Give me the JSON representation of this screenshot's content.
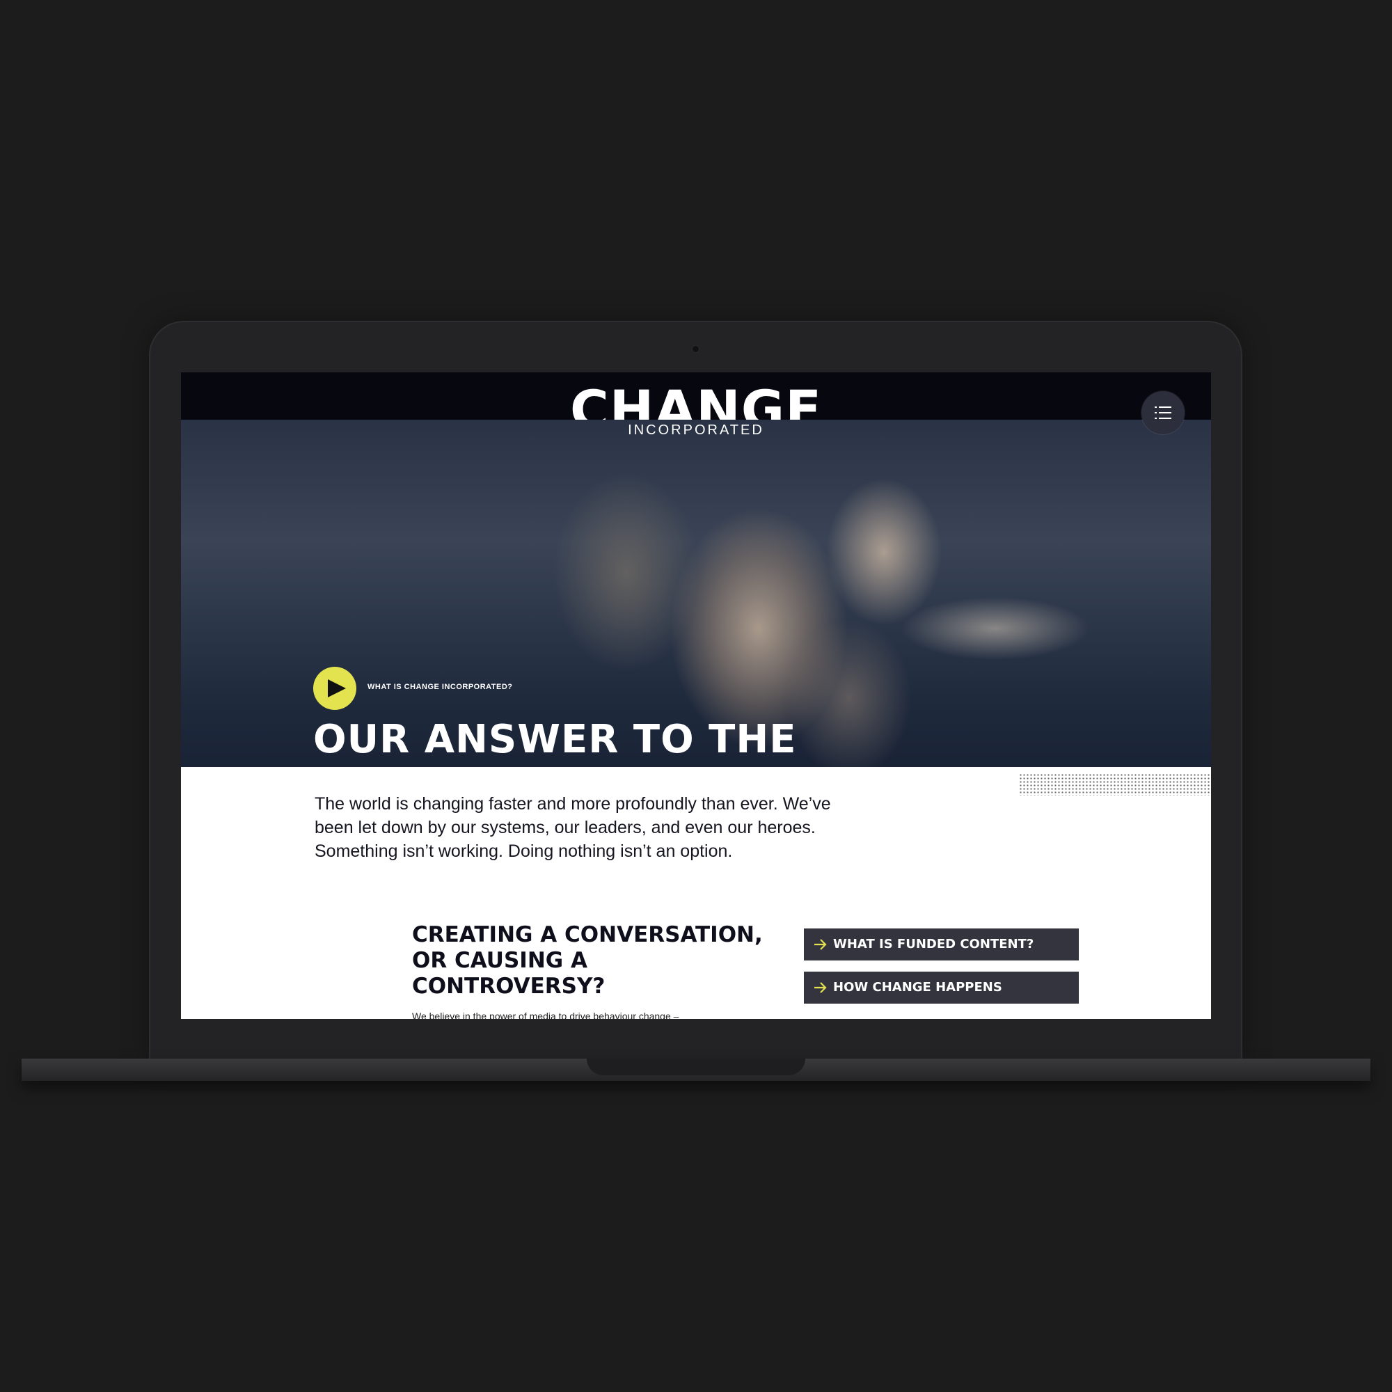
{
  "header": {
    "logo_main": "CHANGE",
    "logo_sub": "INCORPORATED",
    "menu_icon": "menu-list-icon"
  },
  "hero": {
    "video_label": "WHAT IS CHANGE INCORPORATED?",
    "play_icon": "play-icon",
    "title": "OUR ANSWER TO THE NEED FOR CHANGE"
  },
  "intro": {
    "text": "The world is changing faster and more profoundly than ever. We’ve been let down by our systems, our leaders, and even our heroes. Something isn’t working. Doing nothing isn’t an option."
  },
  "section": {
    "title": "CREATING A CONVERSATION, OR CAUSING A CONTROVERSY?",
    "body_partial": "We believe in the power of media to drive behaviour change –"
  },
  "links": [
    {
      "label": "WHAT IS FUNDED CONTENT?",
      "icon": "arrow-right-icon"
    },
    {
      "label": "HOW CHANGE HAPPENS",
      "icon": "arrow-right-icon"
    }
  ],
  "colors": {
    "accent": "#e3e34f",
    "nav_bg": "#06070f",
    "button_bg": "#34343f",
    "page_bg": "#1c1c1c"
  }
}
